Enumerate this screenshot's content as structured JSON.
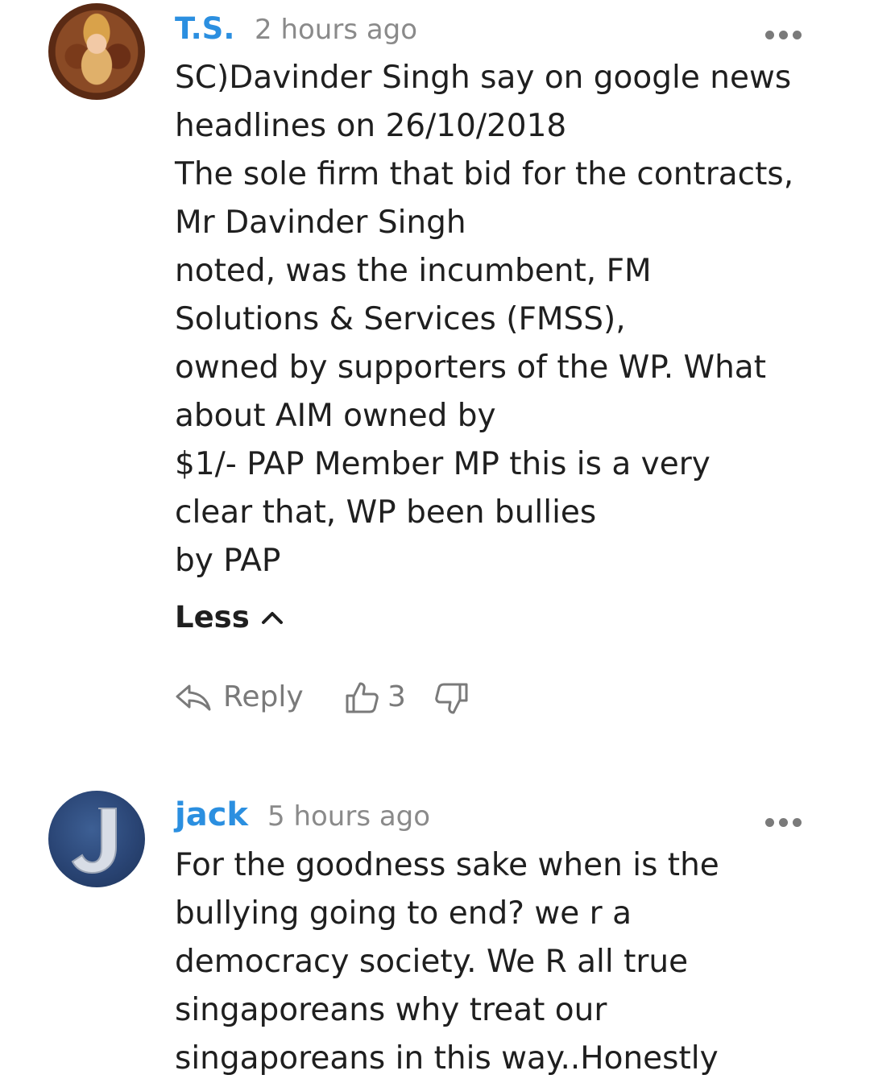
{
  "comments": [
    {
      "author": "T.S.",
      "time": "2 hours ago",
      "avatar_icon": "avatar-deity-image",
      "lines": [
        "SC)Davinder Singh say on google news",
        "headlines on 26/10/2018",
        "The sole firm that bid for the contracts,",
        "Mr Davinder Singh",
        "noted, was the incumbent, FM",
        "Solutions & Services (FMSS),",
        "owned by supporters of the WP. What",
        "about AIM owned by",
        "$1/- PAP Member MP this is a very",
        "clear that, WP been bullies",
        "by PAP"
      ],
      "less_label": "Less",
      "reply_label": "Reply",
      "like_count": "3"
    },
    {
      "author": "jack",
      "time": "5 hours ago",
      "avatar_icon": "avatar-letter-j",
      "lines": [
        "For the goodness sake when is the",
        "bullying going to end? we r a",
        "democracy society. We R all true",
        "singaporeans why treat our",
        "singaporeans in this way..Honestly"
      ]
    }
  ],
  "colors": {
    "author": "#2b8fe0",
    "timestamp": "#8a8a8a",
    "text": "#1f1f1f",
    "icon": "#7a7a7a"
  }
}
